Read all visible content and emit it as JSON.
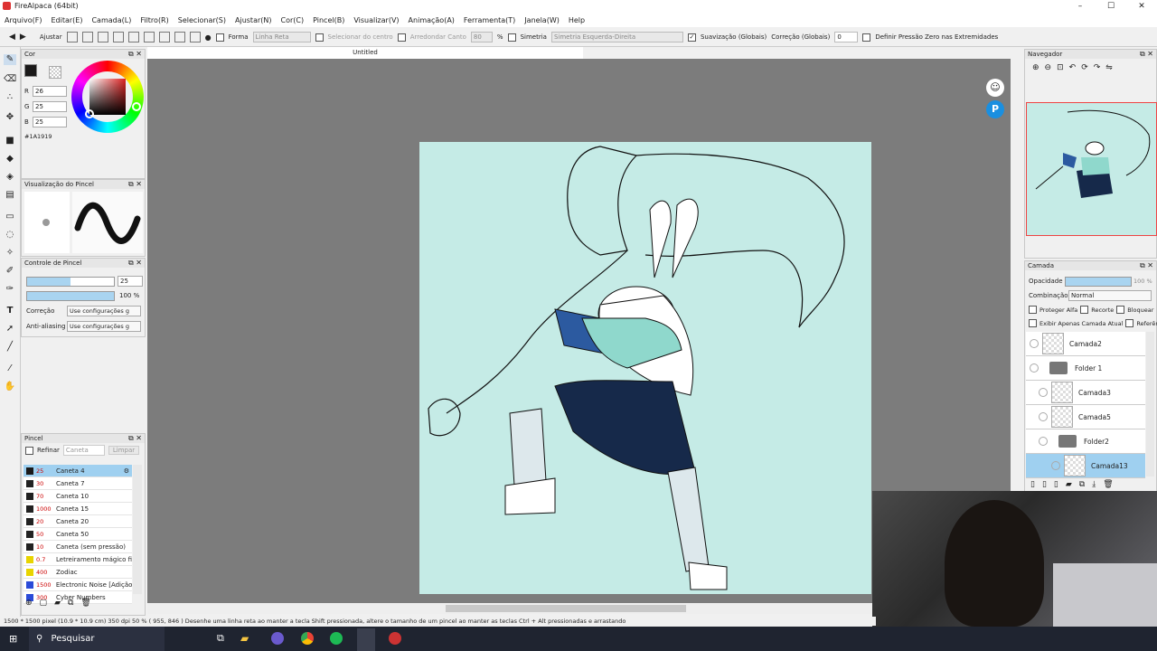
{
  "app": {
    "title": "FireAlpaca (64bit)"
  },
  "window_controls": {
    "minimize": "–",
    "maximize": "☐",
    "close": "✕"
  },
  "menu": [
    "Arquivo(F)",
    "Editar(E)",
    "Camada(L)",
    "Filtro(R)",
    "Selecionar(S)",
    "Ajustar(N)",
    "Cor(C)",
    "Pincel(B)",
    "Visualizar(V)",
    "Animação(A)",
    "Ferramenta(T)",
    "Janela(W)",
    "Help"
  ],
  "options": {
    "ajustar": "Ajustar",
    "forma": "Forma",
    "forma_value": "Linha Reta",
    "selecionar_centro": "Selecionar do centro",
    "arredondar": "Arredondar Canto",
    "arredondar_value": "80",
    "pct": "%",
    "simetria": "Simetria",
    "simetria_value": "Simetria Esquerda-Direita",
    "suavizacao": "Suavização (Globais)",
    "correcao": "Correção (Globais)",
    "correcao_value": "0",
    "pressao": "Definir Pressão Zero nas Extremidades"
  },
  "document": {
    "tab": "Untitled"
  },
  "color_panel": {
    "title": "Cor",
    "r_label": "R",
    "r": "26",
    "g_label": "G",
    "g": "25",
    "b_label": "B",
    "b": "25",
    "hex": "#1A1919",
    "main_color": "#1a1919"
  },
  "brush_preview": {
    "title": "Visualização do Pincel"
  },
  "brush_control": {
    "title": "Controle de Pincel",
    "size": "25",
    "opacity": "100 %",
    "correcao_label": "Correção",
    "correcao_value": "Use configurações g",
    "aa_label": "Anti-aliasing",
    "aa_value": "Use configurações g"
  },
  "brush_panel": {
    "title": "Pincel",
    "refinar": "Refinar",
    "search_placeholder": "Caneta",
    "limpar": "Limpar",
    "items": [
      {
        "size": "25",
        "name": "Caneta 4",
        "color": "#1a1919",
        "selected": true
      },
      {
        "size": "30",
        "name": "Caneta 7",
        "color": "#222222"
      },
      {
        "size": "70",
        "name": "Caneta 10",
        "color": "#222222"
      },
      {
        "size": "1000",
        "name": "Caneta 15",
        "color": "#222222"
      },
      {
        "size": "20",
        "name": "Caneta 20",
        "color": "#222222"
      },
      {
        "size": "50",
        "name": "Caneta 50",
        "color": "#222222"
      },
      {
        "size": "10",
        "name": "Caneta (sem pressão)",
        "color": "#222222"
      },
      {
        "size": "0.7",
        "name": "Letreiramento mágico fi",
        "color": "#e8d400"
      },
      {
        "size": "400",
        "name": "Zodiac",
        "color": "#e8d400"
      },
      {
        "size": "1500",
        "name": "Electronic Noise [Adição",
        "color": "#2b4bd8"
      },
      {
        "size": "300",
        "name": "Cyber Numbers",
        "color": "#2b4bd8"
      }
    ]
  },
  "navigator": {
    "title": "Navegador"
  },
  "layer_panel": {
    "title": "Camada",
    "opacity_label": "Opacidade",
    "opacity_value": "100 %",
    "blend_label": "Combinação",
    "blend_value": "Normal",
    "protect_alpha": "Proteger Alfa",
    "clip": "Recorte",
    "lock": "Bloquear",
    "show_only": "Exibir Apenas Camada Atual",
    "reference": "Referênc",
    "layers": [
      {
        "name": "Camada2",
        "kind": "layer",
        "indent": 0
      },
      {
        "name": "Folder 1",
        "kind": "folder",
        "indent": 0
      },
      {
        "name": "Camada3",
        "kind": "layer",
        "indent": 1
      },
      {
        "name": "Camada5",
        "kind": "layer",
        "indent": 1
      },
      {
        "name": "Folder2",
        "kind": "folder",
        "indent": 1
      },
      {
        "name": "Camada13",
        "kind": "layer",
        "indent": 2,
        "selected": true
      }
    ]
  },
  "status": {
    "text": "1500 * 1500 pixel  (10.9 * 10.9 cm)  350 dpi  50 %  ( 955, 846 )  Desenhe uma linha reta ao manter a tecla Shift pressionada, altere o tamanho de um pincel ao manter as teclas Ctrl + Alt pressionadas e arrastando"
  },
  "taskbar": {
    "search": "Pesquisar"
  }
}
